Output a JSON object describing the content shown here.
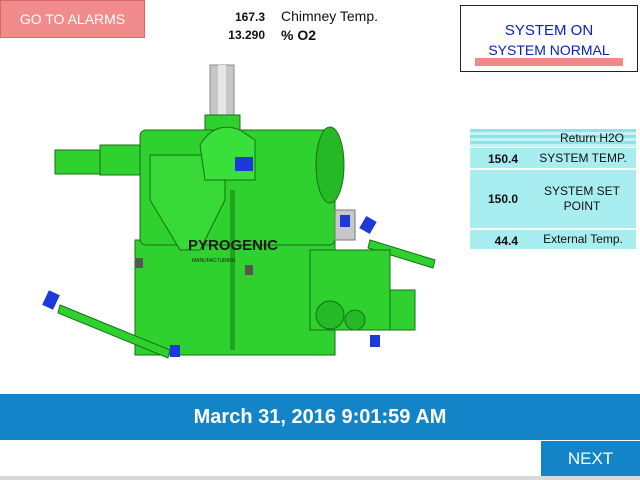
{
  "alarms_button": {
    "label": "GO TO ALARMS"
  },
  "readouts": {
    "chimney_value": "167.3",
    "chimney_label": "Chimney Temp.",
    "o2_value": "13.290",
    "o2_label": "% O2"
  },
  "status": {
    "line1": "SYSTEM ON",
    "line2": "SYSTEM NORMAL"
  },
  "temps": {
    "return_label": "Return H2O",
    "system_temp_value": "150.4",
    "system_temp_label": "SYSTEM TEMP.",
    "set_point_value": "150.0",
    "set_point_label": "SYSTEM SET POINT",
    "external_value": "44.4",
    "external_label": "External Temp."
  },
  "logo": {
    "brand": "PYROGENIC",
    "tagline": "MANUFACTURING"
  },
  "datetime": "March 31, 2016 9:01:59 AM",
  "next_button": {
    "label": "NEXT"
  },
  "colors": {
    "machine_green": "#2fd12f",
    "accent_blue": "#1284c7",
    "alarm_red": "#f28b8b",
    "panel_cyan": "#a8eef0"
  }
}
